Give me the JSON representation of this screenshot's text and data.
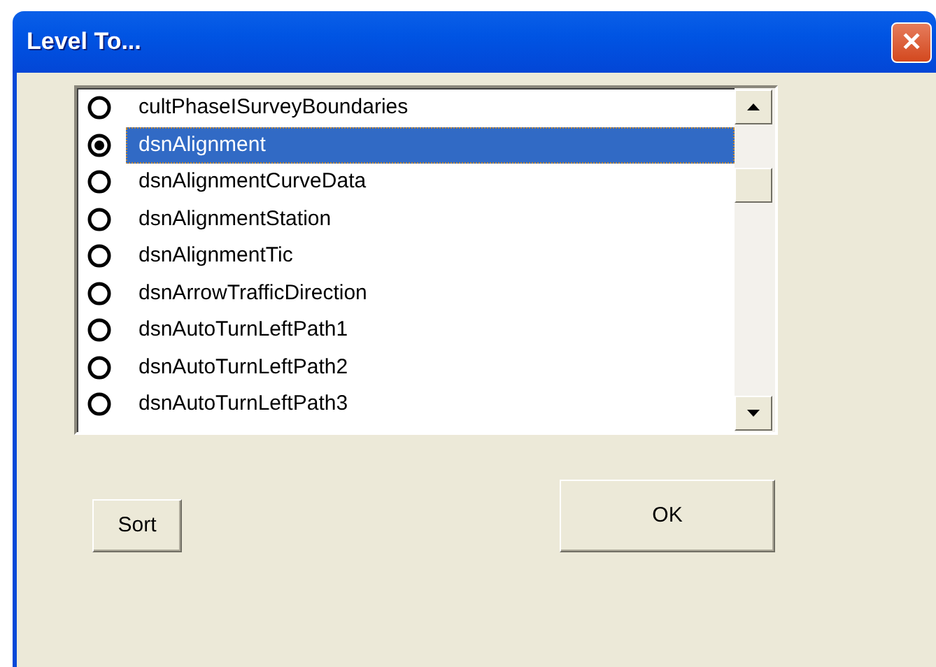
{
  "window": {
    "title": "Level To...",
    "close": "✕"
  },
  "list": {
    "items": [
      {
        "label": "cultPhaseISurveyBoundaries",
        "selected": false
      },
      {
        "label": "dsnAlignment",
        "selected": true
      },
      {
        "label": "dsnAlignmentCurveData",
        "selected": false
      },
      {
        "label": "dsnAlignmentStation",
        "selected": false
      },
      {
        "label": "dsnAlignmentTic",
        "selected": false
      },
      {
        "label": "dsnArrowTrafficDirection",
        "selected": false
      },
      {
        "label": "dsnAutoTurnLeftPath1",
        "selected": false
      },
      {
        "label": "dsnAutoTurnLeftPath2",
        "selected": false
      },
      {
        "label": "dsnAutoTurnLeftPath3",
        "selected": false
      }
    ]
  },
  "buttons": [
    {
      "label": "Sort",
      "kind": "small"
    },
    {
      "label": "OK",
      "kind": "large"
    }
  ]
}
